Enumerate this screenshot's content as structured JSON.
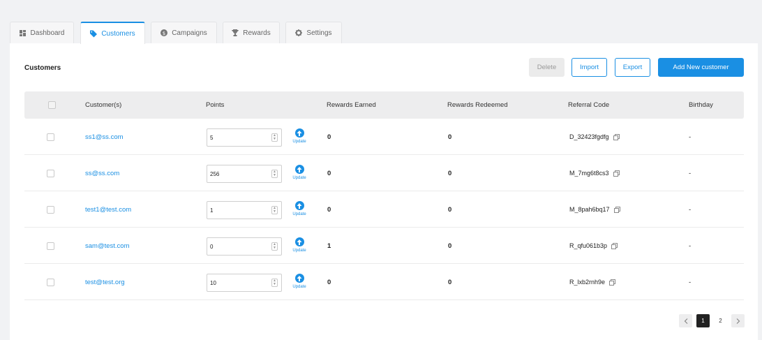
{
  "tabs": [
    {
      "label": "Dashboard",
      "icon": "grid-icon"
    },
    {
      "label": "Customers",
      "icon": "tag-icon"
    },
    {
      "label": "Campaigns",
      "icon": "dollar-icon"
    },
    {
      "label": "Rewards",
      "icon": "trophy-icon"
    },
    {
      "label": "Settings",
      "icon": "gear-icon"
    }
  ],
  "active_tab": "Customers",
  "page": {
    "title": "Customers"
  },
  "toolbar": {
    "delete_label": "Delete",
    "import_label": "Import",
    "export_label": "Export",
    "add_label": "Add New customer"
  },
  "table": {
    "headers": {
      "customer": "Customer(s)",
      "points": "Points",
      "earned": "Rewards Earned",
      "redeemed": "Rewards Redeemed",
      "referral": "Referral Code",
      "birthday": "Birthday"
    },
    "update_label": "Update",
    "rows": [
      {
        "email": "ss1@ss.com",
        "points": "5",
        "earned": "0",
        "redeemed": "0",
        "referral": "D_32423fgdfg",
        "birthday": "-"
      },
      {
        "email": "ss@ss.com",
        "points": "256",
        "earned": "0",
        "redeemed": "0",
        "referral": "M_7mg6t8cs3",
        "birthday": "-"
      },
      {
        "email": "test1@test.com",
        "points": "1",
        "earned": "0",
        "redeemed": "0",
        "referral": "M_8pah6bq17",
        "birthday": "-"
      },
      {
        "email": "sam@test.com",
        "points": "0",
        "earned": "1",
        "redeemed": "0",
        "referral": "R_qfu061b3p",
        "birthday": "-"
      },
      {
        "email": "test@test.org",
        "points": "10",
        "earned": "0",
        "redeemed": "0",
        "referral": "R_lxb2rnh9e",
        "birthday": "-"
      }
    ]
  },
  "pagination": {
    "pages": [
      "1",
      "2"
    ],
    "current": "1"
  },
  "colors": {
    "accent": "#1a8fe3",
    "active_page": "#222222"
  }
}
